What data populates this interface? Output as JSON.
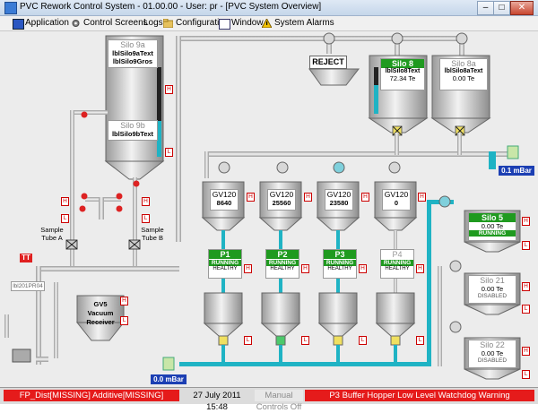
{
  "window": {
    "title": "PVC Rework Control System - 01.00.00 - User: pr - [PVC System Overview]"
  },
  "menu": {
    "application": "Application",
    "control": "Control",
    "screens": "Screens",
    "logs": "Logs",
    "configuration": "Configuration",
    "window": "Window",
    "alarms": "System Alarms"
  },
  "silo9": {
    "name": "Silo 9a",
    "text": "lblSilo9aText",
    "gros": "lblSilo9Gros",
    "name_b": "Silo 9b",
    "text_b": "lblSilo9bText"
  },
  "reject": "REJECT",
  "silo8": {
    "name": "Silo 8",
    "text": "lblSilo8Text",
    "value": "72.34 Te"
  },
  "silo8a": {
    "name": "Silo 8a",
    "text": "lblSilo8aText",
    "value": "0.00 Te"
  },
  "gv": [
    {
      "name": "GV120",
      "value": "8640"
    },
    {
      "name": "GV120",
      "value": "25560"
    },
    {
      "name": "GV120",
      "value": "23580"
    },
    {
      "name": "GV120",
      "value": "0"
    }
  ],
  "pumps": [
    {
      "name": "P1",
      "status": "RUNNING",
      "health": "HEALTHY"
    },
    {
      "name": "P2",
      "status": "RUNNING",
      "health": "HEALTHY"
    },
    {
      "name": "P3",
      "status": "RUNNING",
      "health": "HEALTHY"
    },
    {
      "name": "P4",
      "status": "RUNNING",
      "health": "HEALTHY"
    }
  ],
  "silo5": {
    "name": "Silo 5",
    "value": "0.00 Te",
    "status": "RUNNING"
  },
  "silo21": {
    "name": "Silo 21",
    "value": "0.00 Te",
    "status": "DISABLED"
  },
  "silo22": {
    "name": "Silo 22",
    "value": "0.00 Te",
    "status": "DISABLED"
  },
  "sample_a": "Sample Tube A",
  "sample_b": "Sample Tube B",
  "tt_tag": "TT",
  "tt_label": "lbl201PR04",
  "gv5": {
    "line1": "GV5",
    "line2": "Vacuum",
    "line3": "Receiver"
  },
  "pressure_right": "0.1 mBar",
  "pressure_bottom": "0.0 mBar",
  "tags": {
    "H": "H",
    "L": "L"
  },
  "status": {
    "left": "FP_Dist[MISSING] Additive[MISSING]",
    "date": "27 July 2011 15:48",
    "manual": "Manual Controls Off",
    "alarm": "P3 Buffer Hopper Low Level Watchdog Warning"
  },
  "colors": {
    "accent_green": "#1f9a1f",
    "alarm_red": "#e51b1b",
    "pressure_blue": "#1c3fb3",
    "pipe_cyan": "#1fb3c4"
  }
}
